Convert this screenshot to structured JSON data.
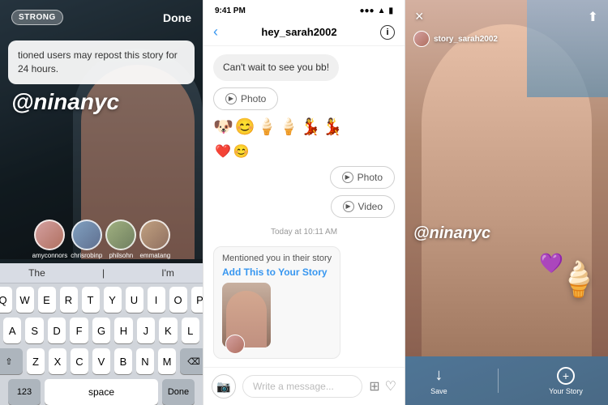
{
  "panel1": {
    "strong_badge": "STRONG",
    "done_btn": "Done",
    "tooltip_text": "tioned users may repost this story for 24 hours.",
    "mention_handle": "@ninanyc",
    "avatars": [
      {
        "label": "amyconnors",
        "class": "a1"
      },
      {
        "label": "chrisrobinp",
        "class": "a2"
      },
      {
        "label": "philsohn",
        "class": "a3"
      },
      {
        "label": "emmatang",
        "class": "a4"
      }
    ],
    "keyboard": {
      "suggestions": [
        "The",
        "I'm"
      ],
      "row1": [
        "Q",
        "W",
        "E",
        "R",
        "T",
        "Y",
        "U",
        "I",
        "O",
        "P"
      ],
      "row2": [
        "A",
        "S",
        "D",
        "F",
        "G",
        "H",
        "J",
        "K",
        "L"
      ],
      "row3": [
        "Z",
        "X",
        "C",
        "V",
        "B",
        "N",
        "M"
      ],
      "space_label": "space",
      "done_label": "Done"
    }
  },
  "panel2": {
    "status_time": "9:41 PM",
    "username": "hey_sarah2002",
    "messages": [
      {
        "text": "Can't wait to see you bb!",
        "type": "received"
      },
      {
        "text": "Photo",
        "type": "media-received"
      },
      {
        "type": "emoji"
      },
      {
        "text": "Photo",
        "type": "media-sent"
      },
      {
        "text": "Video",
        "type": "media-sent"
      }
    ],
    "timestamp": "Today at 10:11 AM",
    "mention_text": "Mentioned you in their story",
    "add_story_text": "Add This to Your Story",
    "input_placeholder": "Write a message..."
  },
  "panel3": {
    "close_icon": "×",
    "user_tag": "story_sarah2002",
    "handle": "@ninanyc",
    "sticker_emoji": "🍦",
    "sticker_heart": "💜",
    "save_label": "Save",
    "your_story_label": "Your Story",
    "save_icon": "↓",
    "add_icon": "+"
  }
}
